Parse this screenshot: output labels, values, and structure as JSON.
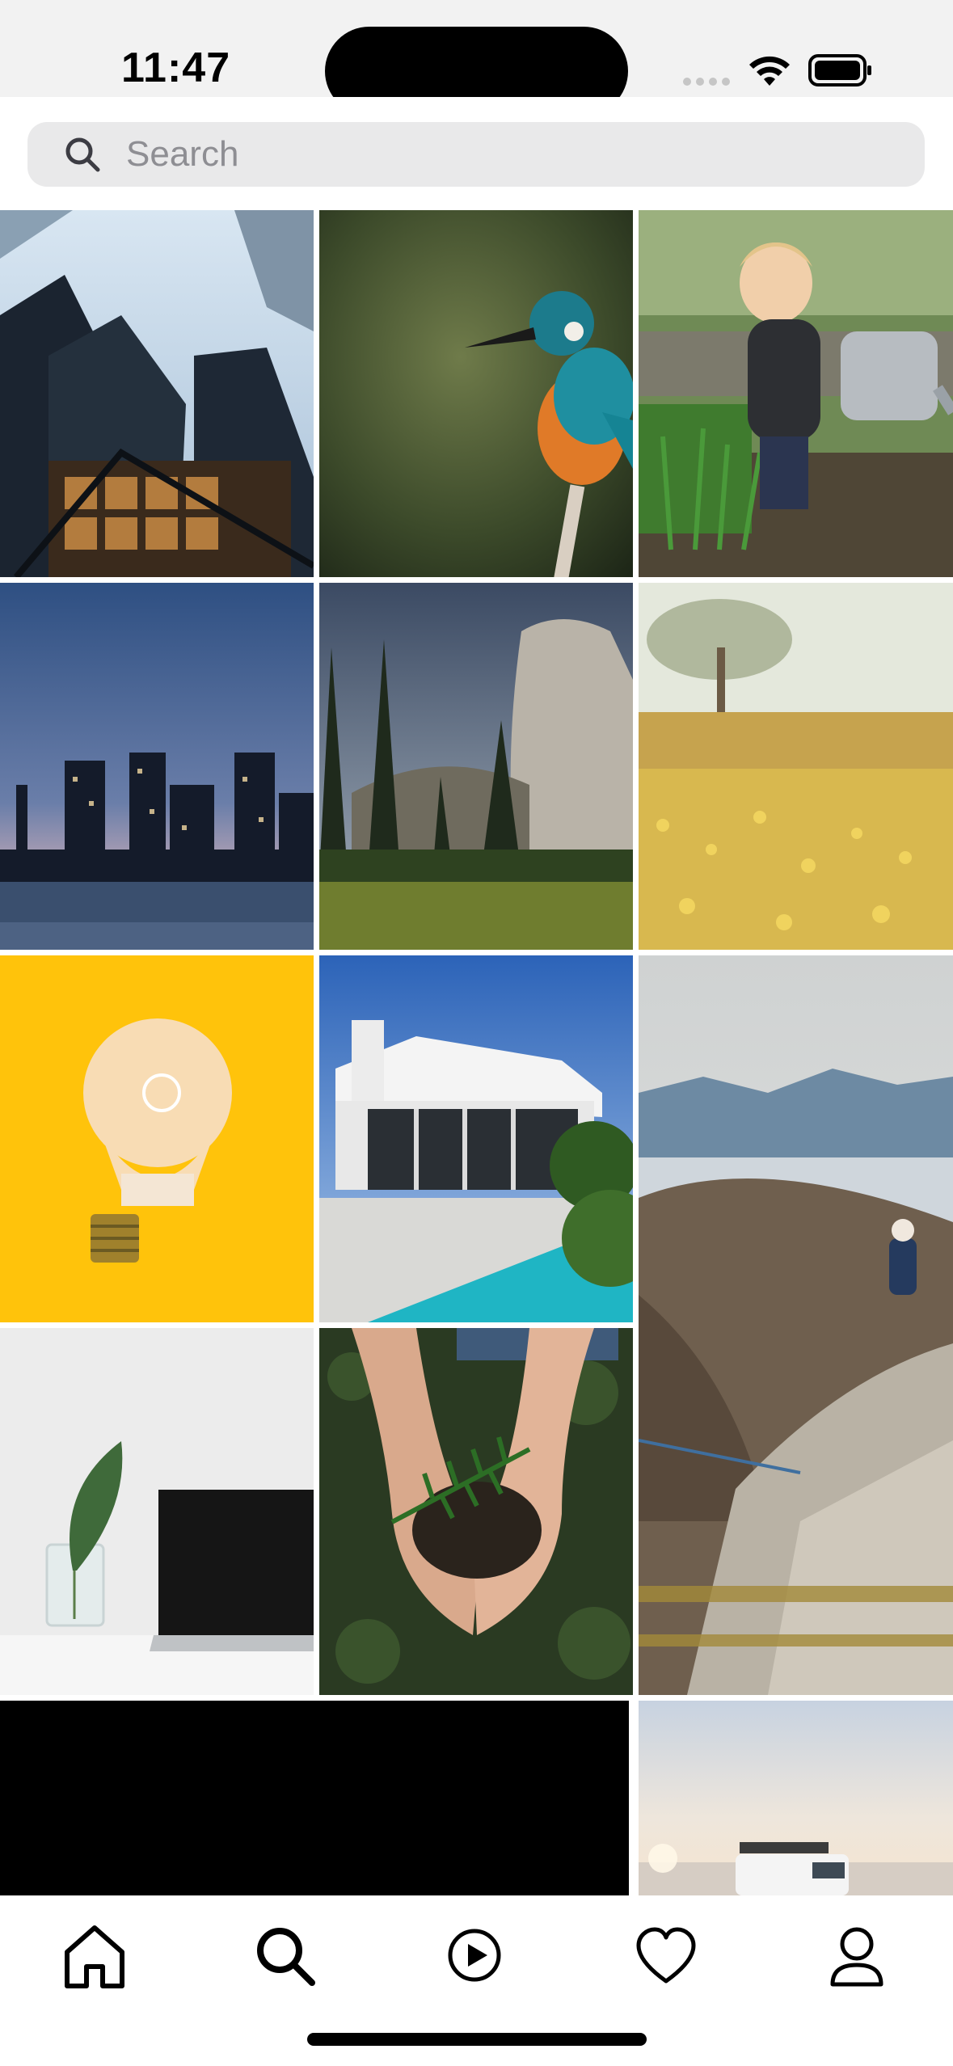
{
  "status_bar": {
    "time": "11:47",
    "signal_icon": "cellular-signal-icon",
    "wifi_icon": "wifi-icon",
    "battery_icon": "battery-icon"
  },
  "search": {
    "placeholder": "Search",
    "value": "",
    "icon": "search-icon"
  },
  "grid": {
    "tiles": [
      {
        "subject": "skyscrapers-looking-up"
      },
      {
        "subject": "kingfisher-on-branch"
      },
      {
        "subject": "child-with-watering-can"
      },
      {
        "subject": "city-skyline-at-dusk"
      },
      {
        "subject": "granite-cliff-and-pines"
      },
      {
        "subject": "tree-in-yellow-meadow"
      },
      {
        "subject": "lightbulb-on-yellow"
      },
      {
        "subject": "modern-white-house-with-pool"
      },
      {
        "subject": "climbers-on-mountain-ridge"
      },
      {
        "subject": "laptop-and-plant-in-vase"
      },
      {
        "subject": "hands-holding-seedling"
      },
      {
        "subject": "dark-video-tile"
      },
      {
        "subject": "white-van-at-sunset"
      }
    ]
  },
  "tab_bar": {
    "tabs": [
      {
        "icon": "home-icon"
      },
      {
        "icon": "search-icon"
      },
      {
        "icon": "play-circle-icon"
      },
      {
        "icon": "heart-icon"
      },
      {
        "icon": "profile-icon"
      }
    ]
  },
  "colors": {
    "status_bar_bg": "#f2f2f2",
    "search_bg": "#e9e9ea",
    "placeholder": "#8e8e93",
    "icon": "#000000"
  }
}
